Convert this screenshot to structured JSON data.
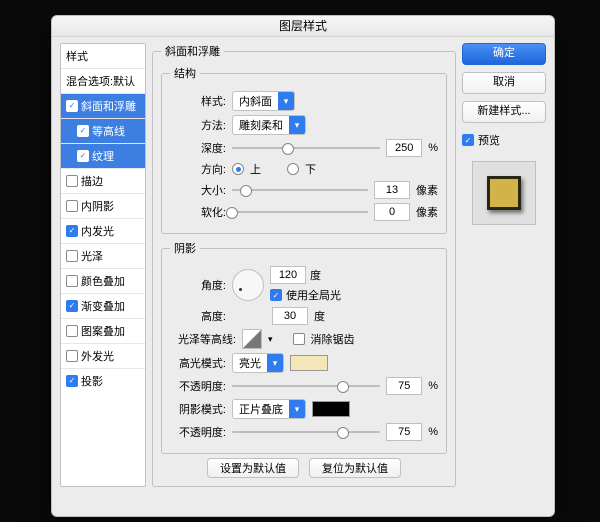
{
  "title": "图层样式",
  "sidebar": {
    "header": "样式",
    "items": [
      {
        "label": "混合选项:默认",
        "checked": null
      },
      {
        "label": "斜面和浮雕",
        "checked": true,
        "selected": true
      },
      {
        "label": "等高线",
        "checked": true,
        "sub": true,
        "selected": true
      },
      {
        "label": "纹理",
        "checked": true,
        "sub": true,
        "selected": true
      },
      {
        "label": "描边",
        "checked": false
      },
      {
        "label": "内阴影",
        "checked": false
      },
      {
        "label": "内发光",
        "checked": true
      },
      {
        "label": "光泽",
        "checked": false
      },
      {
        "label": "颜色叠加",
        "checked": false
      },
      {
        "label": "渐变叠加",
        "checked": true
      },
      {
        "label": "图案叠加",
        "checked": false
      },
      {
        "label": "外发光",
        "checked": false
      },
      {
        "label": "投影",
        "checked": true
      }
    ]
  },
  "panel": {
    "group_label": "斜面和浮雕",
    "structure": {
      "legend": "结构",
      "style_label": "样式:",
      "style_value": "内斜面",
      "method_label": "方法:",
      "method_value": "雕刻柔和",
      "depth_label": "深度:",
      "depth_value": "250",
      "depth_unit": "%",
      "direction_label": "方向:",
      "dir_up": "上",
      "dir_down": "下",
      "size_label": "大小:",
      "size_value": "13",
      "size_unit": "像素",
      "soften_label": "软化:",
      "soften_value": "0",
      "soften_unit": "像素"
    },
    "shading": {
      "legend": "阴影",
      "angle_label": "角度:",
      "angle_value": "120",
      "angle_unit": "度",
      "global_label": "使用全局光",
      "altitude_label": "高度:",
      "altitude_value": "30",
      "altitude_unit": "度",
      "gloss_label": "光泽等高线:",
      "aa_label": "消除锯齿",
      "hl_mode_label": "高光模式:",
      "hl_mode_value": "亮光",
      "hl_color": "#f5e6b8",
      "opacity_label": "不透明度:",
      "hl_opacity": "75",
      "sh_mode_label": "阴影模式:",
      "sh_mode_value": "正片叠底",
      "sh_color": "#000000",
      "sh_opacity": "75",
      "pct": "%"
    },
    "defaults": {
      "set": "设置为默认值",
      "reset": "复位为默认值"
    }
  },
  "right": {
    "ok": "确定",
    "cancel": "取消",
    "new_style": "新建样式...",
    "preview_label": "预览"
  }
}
